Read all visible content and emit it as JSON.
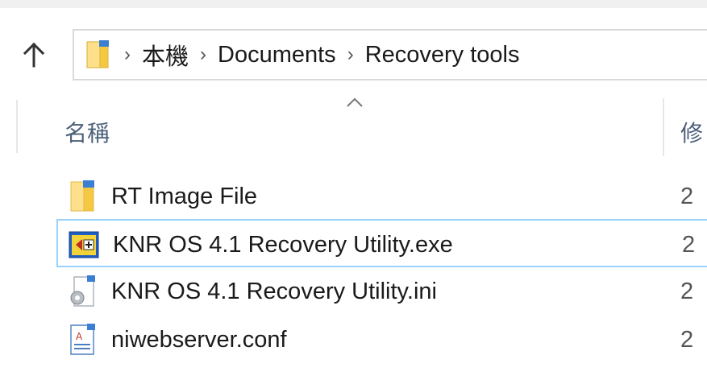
{
  "address_bar": {
    "breadcrumbs": [
      "本機",
      "Documents",
      "Recovery tools"
    ],
    "separator": "›",
    "folder_icon": "folder-icon"
  },
  "columns": {
    "name": "名稱",
    "modified": "修",
    "sort": "ascending"
  },
  "files": [
    {
      "name": "RT Image File",
      "icon": "folder-icon",
      "date": "2",
      "selected": false
    },
    {
      "name": "KNR OS 4.1 Recovery Utility.exe",
      "icon": "labview-exe-icon",
      "date": "2",
      "selected": true
    },
    {
      "name": "KNR OS 4.1 Recovery Utility.ini",
      "icon": "config-settings-icon",
      "date": "2",
      "selected": false
    },
    {
      "name": "niwebserver.conf",
      "icon": "text-document-icon",
      "date": "2",
      "selected": false
    }
  ],
  "colors": {
    "selection_border": "#99d1ff",
    "header_text": "#4c607a",
    "folder_yellow": "#ffd766"
  }
}
